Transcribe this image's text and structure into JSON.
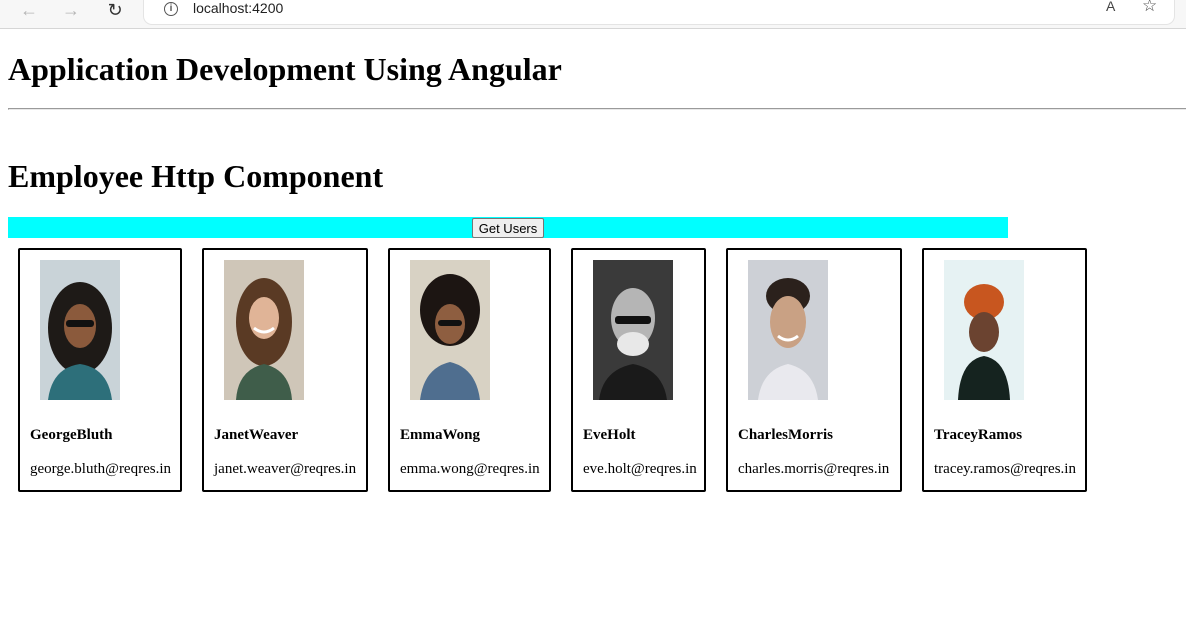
{
  "browser": {
    "url": "localhost:4200",
    "back_icon": "←",
    "forward_icon": "→",
    "reload_icon": "↻",
    "info_icon": "i",
    "readaloud_icon": "A",
    "favorite_icon": "☆"
  },
  "page": {
    "title": "Application Development Using Angular",
    "section_title": "Employee Http Component",
    "action_bar_color": "#00ffff"
  },
  "toolbar": {
    "get_users_label": "Get Users"
  },
  "users": [
    {
      "name": "GeorgeBluth",
      "email": "george.bluth@reqres.in"
    },
    {
      "name": "JanetWeaver",
      "email": "janet.weaver@reqres.in"
    },
    {
      "name": "EmmaWong",
      "email": "emma.wong@reqres.in"
    },
    {
      "name": "EveHolt",
      "email": "eve.holt@reqres.in"
    },
    {
      "name": "CharlesMorris",
      "email": "charles.morris@reqres.in"
    },
    {
      "name": "TraceyRamos",
      "email": "tracey.ramos@reqres.in"
    }
  ]
}
